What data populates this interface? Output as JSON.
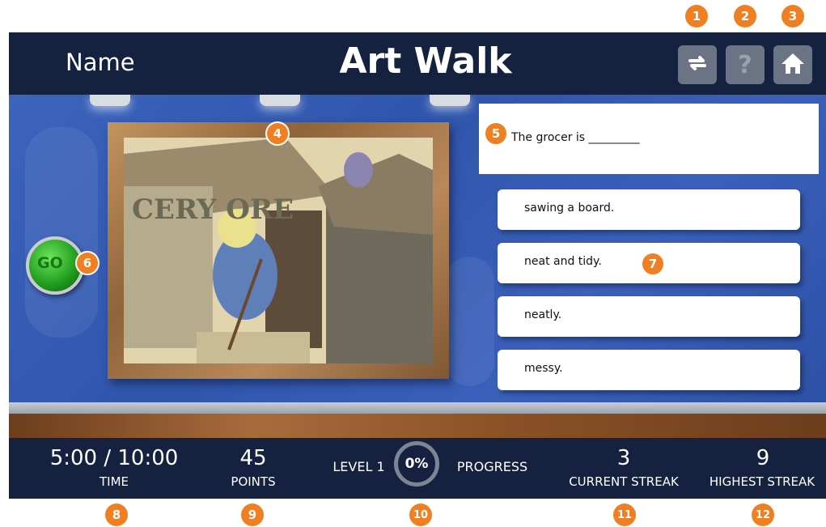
{
  "header": {
    "name_label": "Name",
    "title": "Art Walk",
    "buttons": [
      {
        "icon": "repeat-icon"
      },
      {
        "icon": "help-icon",
        "label": "?"
      },
      {
        "icon": "home-icon"
      }
    ]
  },
  "question": {
    "text": "The grocer is _________"
  },
  "answers": [
    {
      "label": "sawing a board."
    },
    {
      "label": "neat and tidy."
    },
    {
      "label": "neatly."
    },
    {
      "label": "messy."
    }
  ],
  "go_button": {
    "label": "GO"
  },
  "artwork": {
    "sign_text": "CERY ORE"
  },
  "status": {
    "time": {
      "value": "5:00 / 10:00",
      "label": "TIME"
    },
    "points": {
      "value": "45",
      "label": "POINTS"
    },
    "level": {
      "label": "LEVEL 1",
      "progress_value": "0%",
      "progress_label": "PROGRESS"
    },
    "current_streak": {
      "value": "3",
      "label": "CURRENT STREAK"
    },
    "highest_streak": {
      "value": "9",
      "label": "HIGHEST STREAK"
    }
  },
  "callouts": [
    "1",
    "2",
    "3",
    "4",
    "5",
    "6",
    "7",
    "8",
    "9",
    "10",
    "11",
    "12"
  ],
  "colors": {
    "navy": "#15223f",
    "wall_blue": "#3c64bd",
    "callout_orange": "#f07f22",
    "go_green": "#1e9a1c"
  }
}
